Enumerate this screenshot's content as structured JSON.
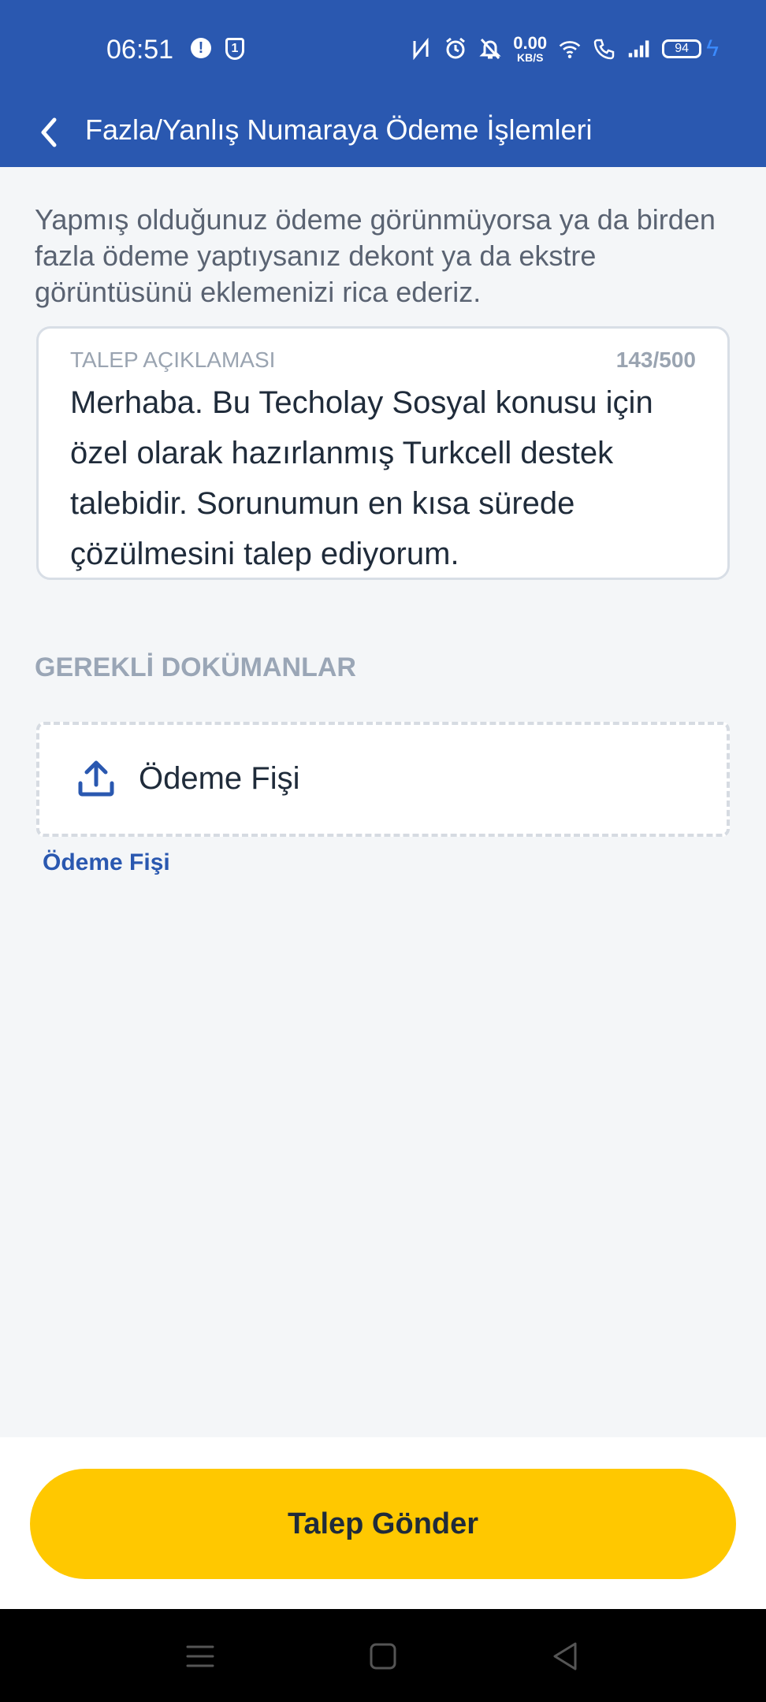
{
  "status_bar": {
    "time": "06:51",
    "alert_badge": "!",
    "shield_badge": "1",
    "net_speed_value": "0.00",
    "net_speed_unit": "KB/S",
    "battery": "94",
    "icons": [
      "nfc-icon",
      "alarm-icon",
      "bell-off-icon",
      "wifi-icon",
      "wifi-calling-icon",
      "signal-icon",
      "battery-icon",
      "charging-icon"
    ]
  },
  "app_bar": {
    "title": "Fazla/Yanlış Numaraya Ödeme İşlemleri"
  },
  "intro_text": "Yapmış olduğunuz ödeme görünmüyorsa ya da birden fazla ödeme yaptıysanız dekont ya da ekstre görüntüsünü eklemenizi rica ederiz.",
  "description_field": {
    "label": "TALEP AÇIKLAMASI",
    "counter": "143/500",
    "value": "Merhaba. Bu Techolay Sosyal konusu için özel olarak hazırlanmış Turkcell destek talebidir. Sorunumun en kısa sürede çözülmesini talep ediyorum."
  },
  "documents": {
    "section_title": "GEREKLİ DOKÜMANLAR",
    "upload_label": "Ödeme Fişi",
    "caption": "Ödeme Fişi"
  },
  "submit_button": {
    "label": "Talep Gönder"
  },
  "colors": {
    "primary_blue": "#2A58B0",
    "accent_yellow": "#FFC800",
    "background": "#F4F6F8"
  }
}
